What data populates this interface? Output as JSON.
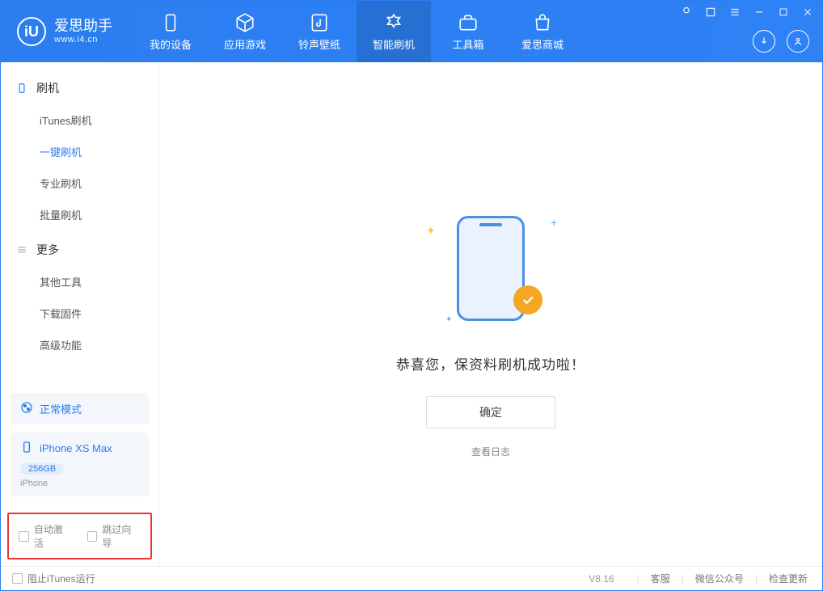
{
  "app": {
    "name": "爱思助手",
    "domain": "www.i4.cn"
  },
  "window_icons": {
    "feedback": "feedback",
    "menu": "menu",
    "skin": "skin",
    "min": "min",
    "max": "max",
    "close": "close"
  },
  "nav": [
    {
      "label": "我的设备",
      "icon": "device"
    },
    {
      "label": "应用游戏",
      "icon": "apps"
    },
    {
      "label": "铃声壁纸",
      "icon": "ringtone"
    },
    {
      "label": "智能刷机",
      "icon": "flash",
      "active": true
    },
    {
      "label": "工具箱",
      "icon": "toolbox"
    },
    {
      "label": "爱思商城",
      "icon": "store"
    }
  ],
  "sidebar": {
    "sections": [
      {
        "title": "刷机",
        "icon": "phone-icon",
        "items": [
          "iTunes刷机",
          "一键刷机",
          "专业刷机",
          "批量刷机"
        ],
        "activeIndex": 1
      },
      {
        "title": "更多",
        "icon": "hamburger-icon",
        "items": [
          "其他工具",
          "下载固件",
          "高级功能"
        ],
        "activeIndex": -1
      }
    ]
  },
  "devices": {
    "mode": {
      "label": "正常模式"
    },
    "device": {
      "name": "iPhone XS Max",
      "capacity": "256GB",
      "type": "iPhone"
    }
  },
  "options": {
    "auto_activate": "自动激活",
    "skip_wizard": "跳过向导"
  },
  "result": {
    "message": "恭喜您，保资料刷机成功啦！",
    "ok": "确定",
    "view_log": "查看日志"
  },
  "footer": {
    "block_itunes": "阻止iTunes运行",
    "version": "V8.16",
    "links": {
      "support": "客服",
      "wechat": "微信公众号",
      "update": "检查更新"
    }
  }
}
